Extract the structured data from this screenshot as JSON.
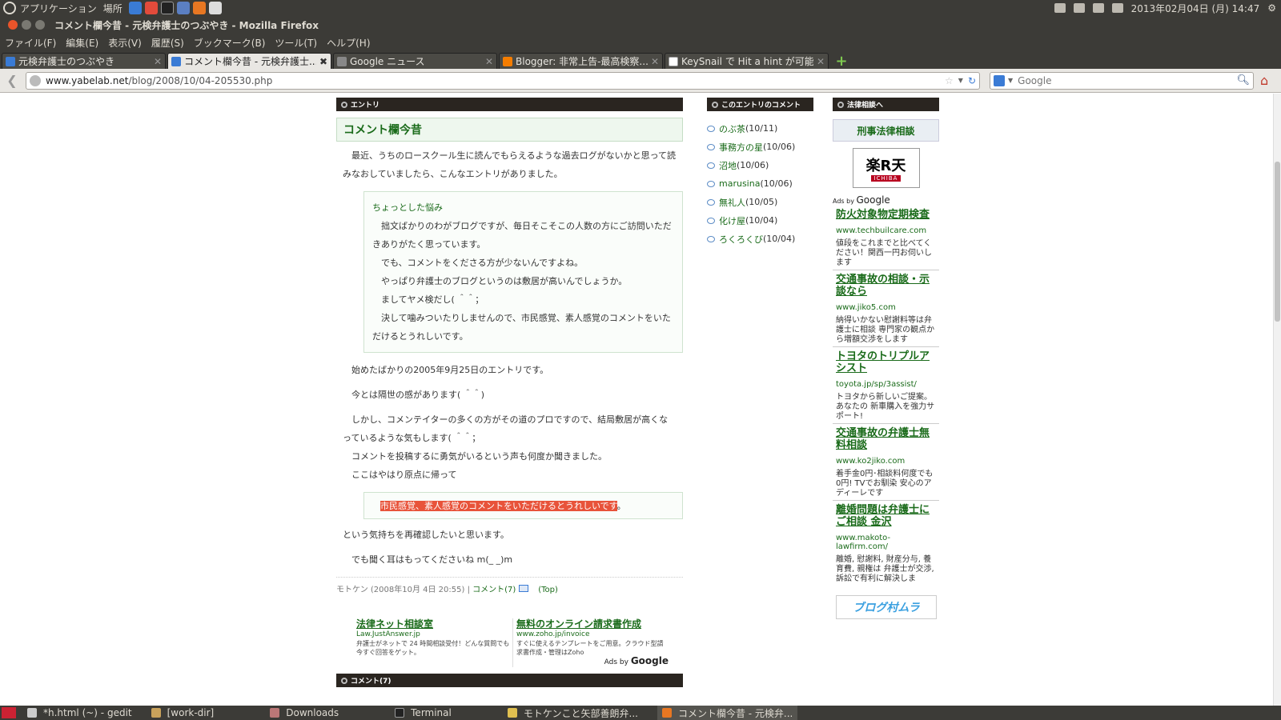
{
  "top_panel": {
    "menu_apps": "アプリケーション",
    "menu_places": "場所",
    "datetime": "2013年02月04日 (月) 14:47"
  },
  "window": {
    "title": "コメント欄今昔 - 元検弁護士のつぶやき - Mozilla Firefox"
  },
  "menubar": {
    "items": [
      "ファイル(F)",
      "編集(E)",
      "表示(V)",
      "履歴(S)",
      "ブックマーク(B)",
      "ツール(T)",
      "ヘルプ(H)"
    ]
  },
  "tabs": [
    {
      "label": "元検弁護士のつぶやき",
      "color": "#3a7bd5"
    },
    {
      "label": "コメント欄今昔 - 元検弁護士...",
      "color": "#3a7bd5"
    },
    {
      "label": "Google ニュース",
      "color": "#888888"
    },
    {
      "label": "Blogger: 非常上告-最高検察...",
      "color": "#f57d00"
    },
    {
      "label": "KeySnail で Hit a hint が可能...",
      "color": "#ffffff"
    }
  ],
  "navbar": {
    "url_domain": "www.yabelab.net",
    "url_path": "/blog/2008/10/04-205530.php",
    "search_placeholder": "Google"
  },
  "entry": {
    "section_label": "エントリ",
    "title": "コメント欄今昔",
    "intro": "最近、うちのロースクール生に読んでもらえるような過去ログがないかと思って読みなおしていましたら、こんなエントリがありました。",
    "quote_title": "ちょっとした悩み",
    "quote_lines": [
      "拙文ばかりのわがブログですが、毎日そこそこの人数の方にご訪問いただきありがたく思っています。",
      "でも、コメントをくださる方が少ないんですよね。",
      "やっぱり弁護士のブログというのは敷居が高いんでしょうか。",
      "ましてヤメ検だし( ＾＾；",
      "決して噛みついたりしませんので、市民感覚、素人感覚のコメントをいただけるとうれしいです。"
    ],
    "p1": "始めたばかりの2005年9月25日のエントリです。",
    "p2": "今とは隔世の感があります( ＾＾)",
    "p3": "しかし、コメンテイターの多くの方がその道のプロですので、結局敷居が高くなっているような気もします( ＾＾；",
    "p4": "コメントを投稿するに勇気がいるという声も何度か聞きました。",
    "p5": "ここはやはり原点に帰って",
    "highlight": "市民感覚、素人感覚のコメントをいただけるとうれしいです",
    "highlight_suffix": "。",
    "p6": "という気持ちを再確認したいと思います。",
    "p7": "でも聞く耳はもってくださいね m(_ _)m",
    "meta_author": "モトケン (2008年10月 4日 20:55)",
    "meta_comments": "コメント(7)",
    "meta_top": "(Top)",
    "comments_section_label": "コメント(7)"
  },
  "bottom_ads": [
    {
      "title": "法律ネット相談室",
      "url": "Law.JustAnswer.jp",
      "desc": "弁護士がネットで 24 時間相談受付！どんな質問でも今すぐ回答をゲット。"
    },
    {
      "title": "無料のオンライン請求書作成",
      "url": "www.zoho.jp/invoice",
      "desc": "すぐに使えるテンプレートをご用意。クラウド型請求書作成・管理はZoho"
    }
  ],
  "ads_by": "Ads by",
  "google_word": "Google",
  "recent_comments": {
    "label": "このエントリのコメント",
    "items": [
      {
        "name": "のぶ茶",
        "date": "(10/11)"
      },
      {
        "name": "事務方の星",
        "date": "(10/06)"
      },
      {
        "name": "沼地",
        "date": "(10/06)"
      },
      {
        "name": "marusina",
        "date": "(10/06)"
      },
      {
        "name": "無礼人",
        "date": "(10/05)"
      },
      {
        "name": "化け屋",
        "date": "(10/04)"
      },
      {
        "name": "ろくろくび",
        "date": "(10/04)"
      }
    ]
  },
  "law_column": {
    "label": "法律相談へ",
    "link": "刑事法律相談",
    "rakuten_big": "楽R天",
    "rakuten_small": "ICHIBA",
    "blogmura": "ブログ村ムラ"
  },
  "side_ads": [
    {
      "title": "防火対象物定期検査",
      "url": "www.techbuilcare.com",
      "desc": "値段をこれまでと比べてください！関西一円お伺いします"
    },
    {
      "title": "交通事故の相談・示談なら",
      "url": "www.jiko5.com",
      "desc": "納得いかない慰謝料等は弁護士に相談 専門家の観点から増額交渉をします"
    },
    {
      "title": "トヨタのトリプルアシスト",
      "url": "toyota.jp/sp/3assist/",
      "desc": "トヨタから新しいご提案。あなたの 新車購入を強力サポート!"
    },
    {
      "title": "交通事故の弁護士無料相談",
      "url": "www.ko2jiko.com",
      "desc": "着手金0円･相談料何度でも0円! TVでお馴染 安心のアディーレです"
    },
    {
      "title": "離婚問題は弁護士にご相談 金沢",
      "url": "www.makoto-lawfirm.com/",
      "desc": "離婚, 慰謝料, 財産分与, 養育費, 親権は 弁護士が交渉, 訴訟で有利に解決しま"
    }
  ],
  "taskbar": [
    {
      "label": "*h.html (~) - gedit"
    },
    {
      "label": "[work-dir]"
    },
    {
      "label": "Downloads"
    },
    {
      "label": "Terminal"
    },
    {
      "label": "モトケンこと矢部善朗弁..."
    },
    {
      "label": "コメント欄今昔 - 元検弁..."
    }
  ],
  "colors": {
    "panel": "#3c3b37",
    "accent_green": "#1a6b1a",
    "header_dark": "#2a2520",
    "highlight": "#e8533a"
  }
}
